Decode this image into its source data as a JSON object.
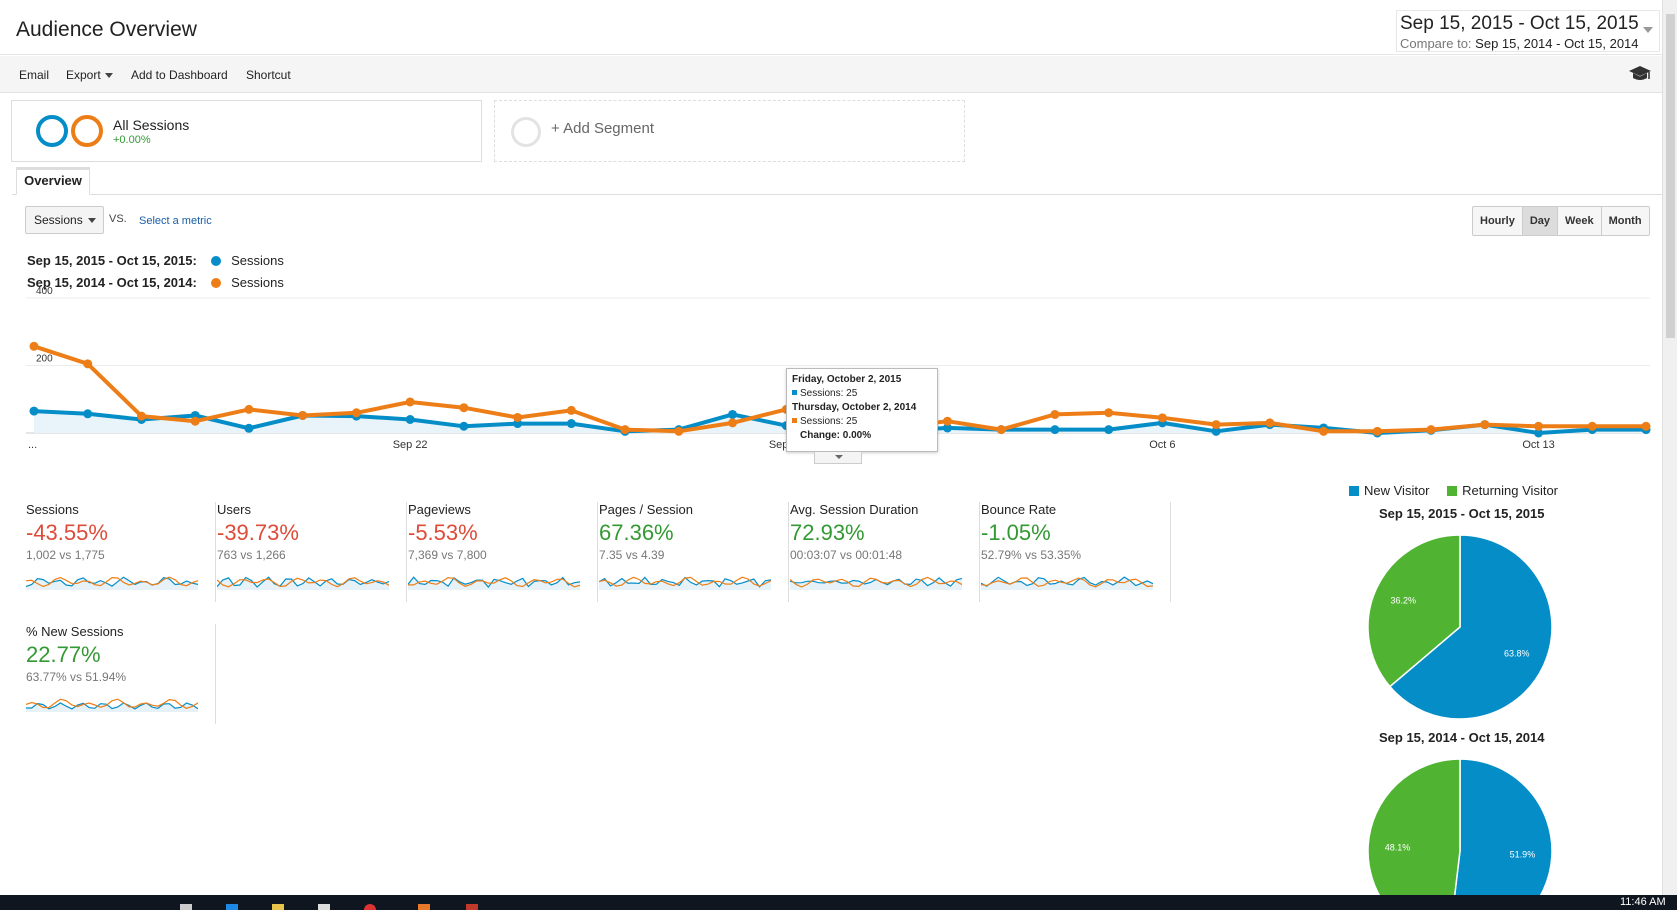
{
  "header": {
    "title": "Audience Overview",
    "date_range": "Sep 15, 2015 - Oct 15, 2015",
    "compare_label": "Compare to:",
    "compare_range": "Sep 15, 2014 - Oct 15, 2014"
  },
  "toolbar": {
    "email": "Email",
    "export": "Export",
    "add_to_dashboard": "Add to Dashboard",
    "shortcut": "Shortcut",
    "help_icon": "graduation-cap-icon"
  },
  "segments": {
    "name": "All Sessions",
    "pct": "+0.00%",
    "add_label": "+ Add Segment"
  },
  "tabs": {
    "overview": "Overview"
  },
  "controls": {
    "metric": "Sessions",
    "vs": "VS.",
    "select_metric": "Select a metric",
    "periods": [
      "Hourly",
      "Day",
      "Week",
      "Month"
    ],
    "active_period": "Day"
  },
  "legend": {
    "current_range": "Sep 15, 2015 - Oct 15, 2015:",
    "current_series": "Sessions",
    "prior_range": "Sep 15, 2014 - Oct 15, 2014:",
    "prior_series": "Sessions"
  },
  "colors": {
    "current": "#058dc7",
    "prior": "#ed7e17",
    "new_visitor": "#058dc7",
    "returning_visitor": "#50b432"
  },
  "chart_data": [
    {
      "type": "line",
      "y_ticks": [
        200,
        400
      ],
      "ylim": [
        0,
        400
      ],
      "x_tick_labels": [
        "...",
        "Sep 22",
        "Sep 29",
        "Oct 6",
        "Oct 13"
      ],
      "x": [
        "Sep 15",
        "Sep 16",
        "Sep 17",
        "Sep 18",
        "Sep 19",
        "Sep 20",
        "Sep 21",
        "Sep 22",
        "Sep 23",
        "Sep 24",
        "Sep 25",
        "Sep 26",
        "Sep 27",
        "Sep 28",
        "Sep 29",
        "Sep 30",
        "Oct 1",
        "Oct 2",
        "Oct 3",
        "Oct 4",
        "Oct 5",
        "Oct 6",
        "Oct 7",
        "Oct 8",
        "Oct 9",
        "Oct 10",
        "Oct 11",
        "Oct 12",
        "Oct 13",
        "Oct 14",
        "Oct 15"
      ],
      "series": [
        {
          "name": "Sessions",
          "range": "Sep 15, 2015 - Oct 15, 2015",
          "values": [
            65,
            57,
            40,
            52,
            14,
            52,
            50,
            40,
            20,
            28,
            28,
            5,
            10,
            55,
            22,
            25,
            5,
            15,
            10,
            10,
            10,
            30,
            5,
            25,
            15,
            0,
            8,
            25,
            0,
            10,
            10
          ]
        },
        {
          "name": "Sessions",
          "range": "Sep 15, 2014 - Oct 15, 2014",
          "values": [
            257,
            205,
            50,
            35,
            70,
            52,
            60,
            92,
            75,
            46,
            67,
            10,
            5,
            30,
            70,
            25,
            15,
            35,
            10,
            55,
            60,
            45,
            25,
            30,
            5,
            5,
            10,
            25,
            20,
            20,
            20
          ]
        }
      ],
      "tooltip": {
        "date1": "Friday, October 2, 2015",
        "value1": "Sessions: 25",
        "date2": "Thursday, October 2, 2014",
        "value2": "Sessions: 25",
        "change": "Change: 0.00%"
      }
    },
    {
      "type": "pie",
      "title": "Sep 15, 2015 - Oct 15, 2015",
      "categories": [
        "New Visitor",
        "Returning Visitor"
      ],
      "values": [
        63.8,
        36.2
      ],
      "labels": [
        "63.8%",
        "36.2%"
      ]
    },
    {
      "type": "pie",
      "title": "Sep 15, 2014 - Oct 15, 2014",
      "categories": [
        "New Visitor",
        "Returning Visitor"
      ],
      "values": [
        51.9,
        48.1
      ],
      "labels": [
        "51.9%",
        "48.1%"
      ]
    }
  ],
  "scorecards": [
    {
      "label": "Sessions",
      "pct": "-43.55%",
      "compare": "1,002 vs 1,775",
      "trend": "down"
    },
    {
      "label": "Users",
      "pct": "-39.73%",
      "compare": "763 vs 1,266",
      "trend": "down"
    },
    {
      "label": "Pageviews",
      "pct": "-5.53%",
      "compare": "7,369 vs 7,800",
      "trend": "down"
    },
    {
      "label": "Pages / Session",
      "pct": "67.36%",
      "compare": "7.35 vs 4.39",
      "trend": "up"
    },
    {
      "label": "Avg. Session Duration",
      "pct": "72.93%",
      "compare": "00:03:07 vs 00:01:48",
      "trend": "up"
    },
    {
      "label": "Bounce Rate",
      "pct": "-1.05%",
      "compare": "52.79% vs 53.35%",
      "trend": "up"
    },
    {
      "label": "% New Sessions",
      "pct": "22.77%",
      "compare": "63.77% vs 51.94%",
      "trend": "up"
    }
  ],
  "pie_legend": {
    "new_visitor": "New Visitor",
    "returning_visitor": "Returning Visitor"
  },
  "taskbar": {
    "clock": "11:46 AM"
  }
}
